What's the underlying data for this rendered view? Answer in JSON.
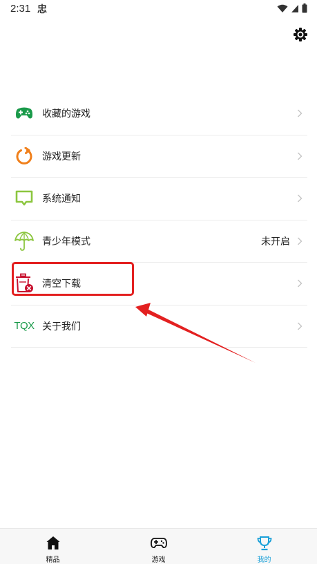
{
  "status_bar": {
    "time": "2:31",
    "app_icon": "忠"
  },
  "header": {
    "settings_icon": "gear-icon"
  },
  "menu": {
    "items": [
      {
        "label": "收藏的游戏",
        "value": "",
        "icon": "gamepad-icon",
        "color": "#1a9a4a"
      },
      {
        "label": "游戏更新",
        "value": "",
        "icon": "refresh-icon",
        "color": "#f07f1a"
      },
      {
        "label": "系统通知",
        "value": "",
        "icon": "message-icon",
        "color": "#8cc63f"
      },
      {
        "label": "青少年模式",
        "value": "未开启",
        "icon": "umbrella-icon",
        "color": "#8cc63f"
      },
      {
        "label": "清空下载",
        "value": "",
        "icon": "trash-icon",
        "color": "#c8102e"
      },
      {
        "label": "关于我们",
        "value": "",
        "icon": "tqx-logo",
        "logo_text": "TQX",
        "color": "#1a9a4a"
      }
    ]
  },
  "annotation": {
    "highlight_color": "#e32020"
  },
  "bottom_nav": {
    "tabs": [
      {
        "label": "精品",
        "icon": "home-icon",
        "active": false
      },
      {
        "label": "游戏",
        "icon": "gamepad-icon",
        "active": false
      },
      {
        "label": "我的",
        "icon": "trophy-icon",
        "active": true
      }
    ],
    "active_color": "#1aa0d8"
  }
}
